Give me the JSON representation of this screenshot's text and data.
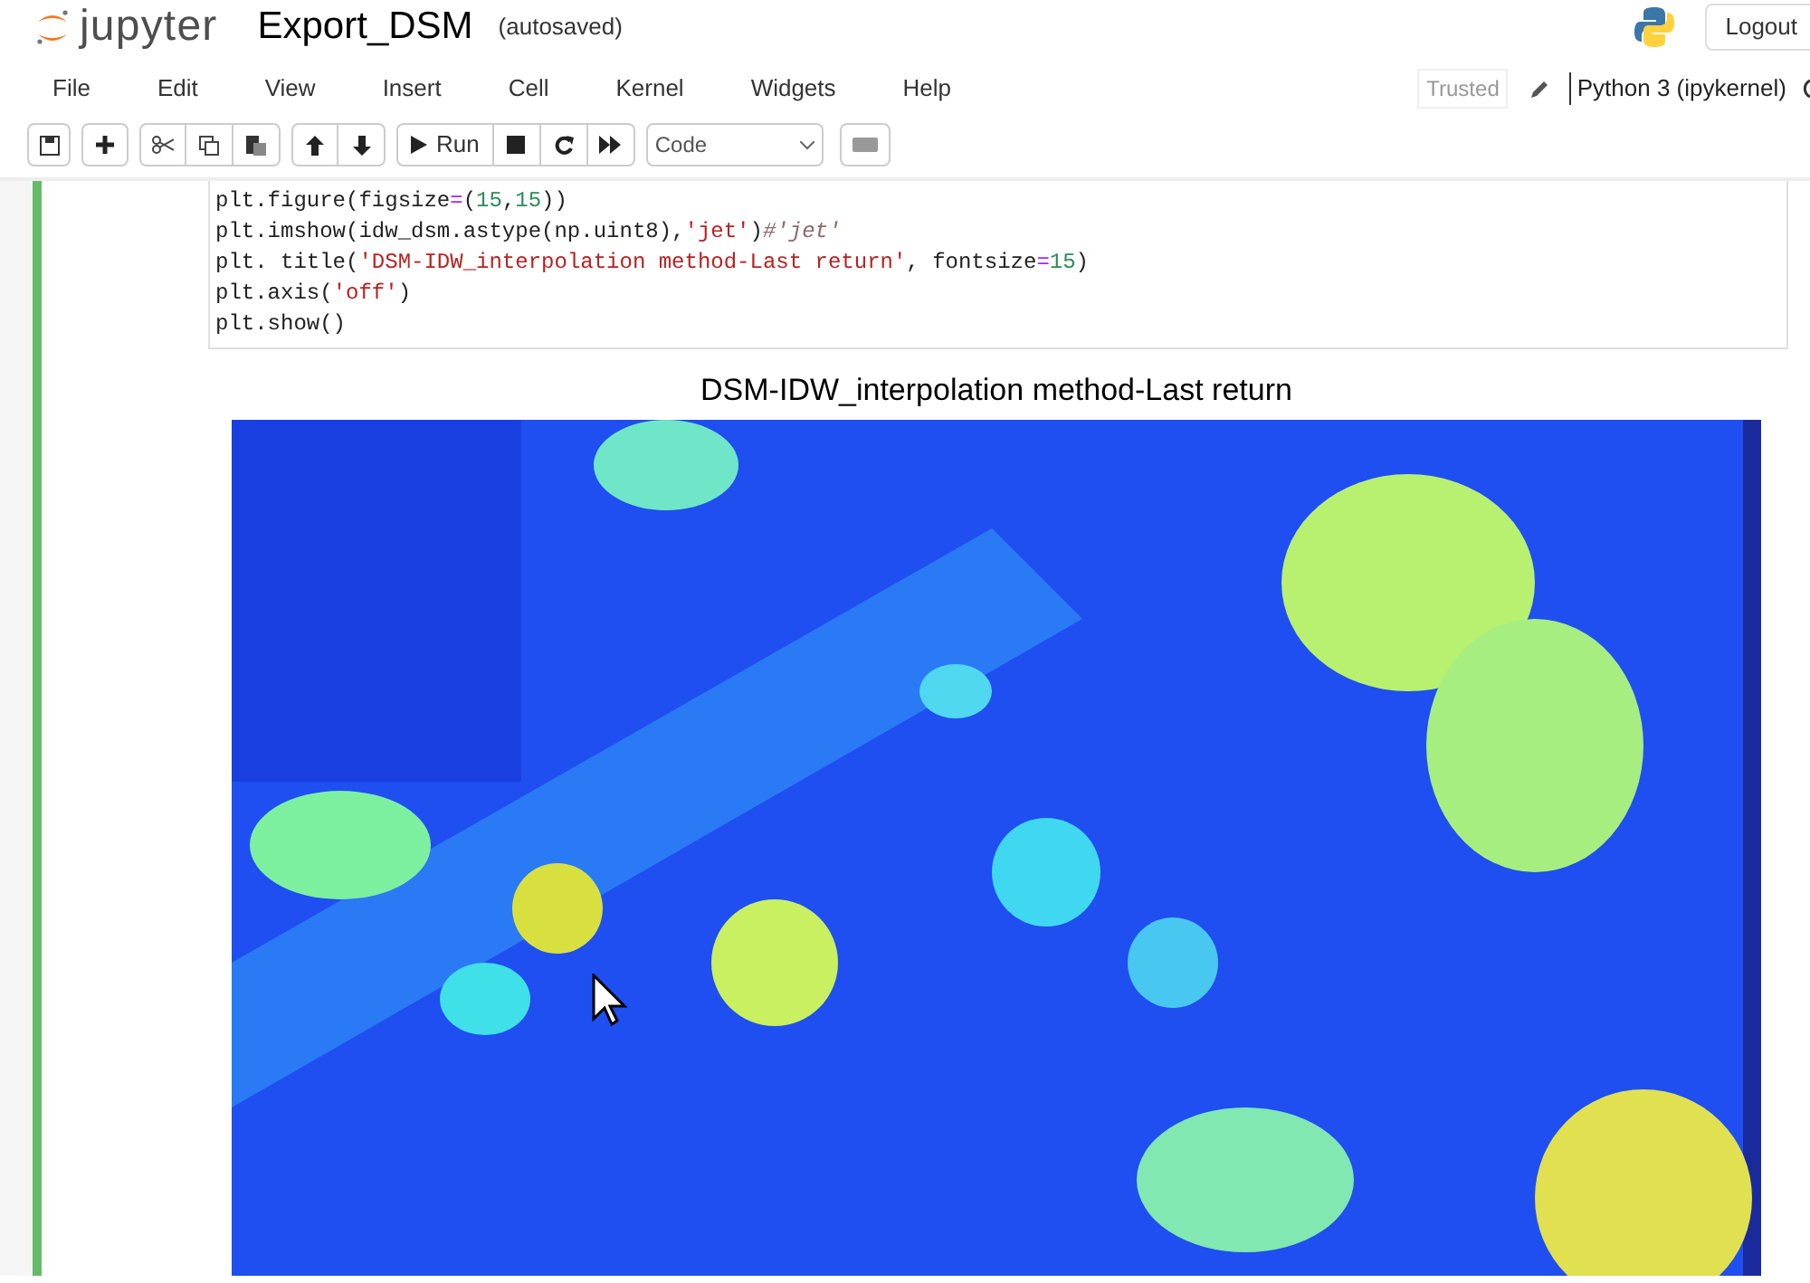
{
  "header": {
    "logo_text": "jupyter",
    "notebook_name": "Export_DSM",
    "save_status": "(autosaved)",
    "logout": "Logout"
  },
  "menu": [
    "File",
    "Edit",
    "View",
    "Insert",
    "Cell",
    "Kernel",
    "Widgets",
    "Help"
  ],
  "kernel": {
    "trusted": "Trusted",
    "name": "Python 3 (ipykernel)"
  },
  "toolbar": {
    "run": "Run",
    "cell_type": "Code"
  },
  "cell": {
    "lines": [
      [
        {
          "kind": "plain",
          "text": "plt.figure(figsize"
        },
        {
          "kind": "op",
          "text": "="
        },
        {
          "kind": "plain",
          "text": "("
        },
        {
          "kind": "num",
          "text": "15"
        },
        {
          "kind": "plain",
          "text": ","
        },
        {
          "kind": "num",
          "text": "15"
        },
        {
          "kind": "plain",
          "text": "))"
        }
      ],
      [
        {
          "kind": "plain",
          "text": "plt.imshow(idw_dsm.astype(np.uint8),"
        },
        {
          "kind": "str",
          "text": "'jet'"
        },
        {
          "kind": "plain",
          "text": ")"
        },
        {
          "kind": "comment",
          "text": "#'jet'"
        }
      ],
      [
        {
          "kind": "plain",
          "text": "plt. title("
        },
        {
          "kind": "str",
          "text": "'DSM-IDW_interpolation method-Last return'"
        },
        {
          "kind": "plain",
          "text": ", fontsize"
        },
        {
          "kind": "op",
          "text": "="
        },
        {
          "kind": "num",
          "text": "15"
        },
        {
          "kind": "plain",
          "text": ")"
        }
      ],
      [
        {
          "kind": "plain",
          "text": "plt.axis("
        },
        {
          "kind": "str",
          "text": "'off'"
        },
        {
          "kind": "plain",
          "text": ")"
        }
      ],
      [
        {
          "kind": "plain",
          "text": "plt.show()"
        }
      ]
    ]
  },
  "output": {
    "title": "DSM-IDW_interpolation method-Last return",
    "kind": "picture"
  }
}
